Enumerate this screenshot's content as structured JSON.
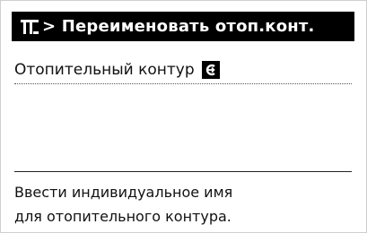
{
  "header": {
    "breadcrumb_icon": "heating-circuit-menu-icon",
    "title": "> Переименовать отоп.конт."
  },
  "field": {
    "label": "Отопительный контур",
    "edit_icon": "edit-text-icon"
  },
  "help": {
    "line1": "Ввести индивидуальное имя",
    "line2": "для отопительного контура."
  },
  "colors": {
    "header_bg": "#000000",
    "header_fg": "#ffffff",
    "background": "#ffffff",
    "text": "#111111"
  }
}
